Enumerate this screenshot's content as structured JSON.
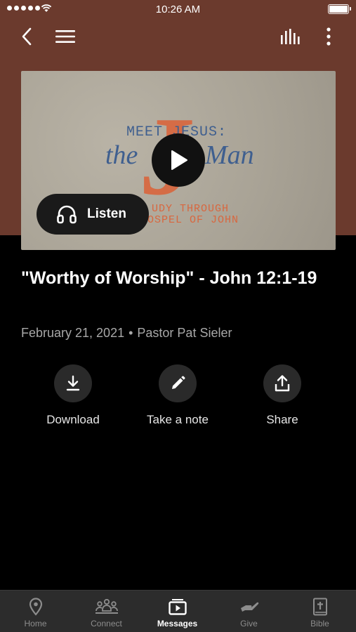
{
  "status_bar": {
    "time": "10:26 AM"
  },
  "media": {
    "series_line1": "MEET JESUS:",
    "series_line2a": "the",
    "series_line2b": "Man",
    "series_line3": "UDY THROUGH",
    "series_line4": "OSPEL OF JOHN",
    "numeral": "J",
    "listen_label": "Listen"
  },
  "sermon": {
    "title": "\"Worthy of Worship\" - John 12:1-19",
    "date": "February 21, 2021",
    "separator": "•",
    "speaker": "Pastor Pat Sieler"
  },
  "actions": [
    {
      "label": "Download",
      "icon": "download-icon"
    },
    {
      "label": "Take a note",
      "icon": "pencil-icon"
    },
    {
      "label": "Share",
      "icon": "share-icon"
    }
  ],
  "tabs": [
    {
      "label": "Home",
      "icon": "location-pin-icon"
    },
    {
      "label": "Connect",
      "icon": "people-icon"
    },
    {
      "label": "Messages",
      "icon": "play-video-icon",
      "active": true
    },
    {
      "label": "Give",
      "icon": "giving-hand-icon"
    },
    {
      "label": "Bible",
      "icon": "bible-icon"
    }
  ],
  "colors": {
    "header_bg": "#6b3a2d",
    "background": "#000000",
    "tabbar_bg": "#2c2c2c",
    "accent_orange": "#d8673f",
    "title_blue": "#3f5f8f"
  }
}
